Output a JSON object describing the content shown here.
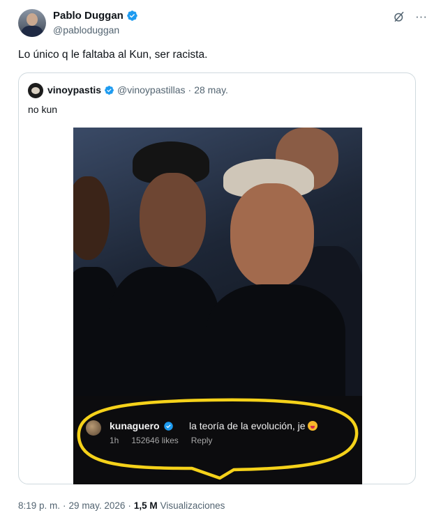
{
  "author": {
    "name": "Pablo Duggan",
    "handle": "@pabloduggan"
  },
  "tweet_text": "Lo único q le faltaba al Kun, ser racista.",
  "icons": {
    "verified": "verified-badge-icon",
    "grok": "grok-icon",
    "more": "more-icon"
  },
  "colors": {
    "verified_blue": "#1d9bf0",
    "highlight_yellow": "#f5d21a",
    "text_secondary": "#536471"
  },
  "quote": {
    "name": "vinoypastis",
    "handle": "@vinoypastillas",
    "separator": "·",
    "date": "28 may.",
    "text": "no kun"
  },
  "media_comment": {
    "user": "kunaguero",
    "text": "la teoría de la evolución, je",
    "time": "1h",
    "likes": "152646 likes",
    "reply": "Reply"
  },
  "footer": {
    "time": "8:19 p. m.",
    "separator": "·",
    "date": "29 may. 2026",
    "separator2": "·",
    "views": "1,5 M",
    "views_label": "Visualizaciones"
  }
}
